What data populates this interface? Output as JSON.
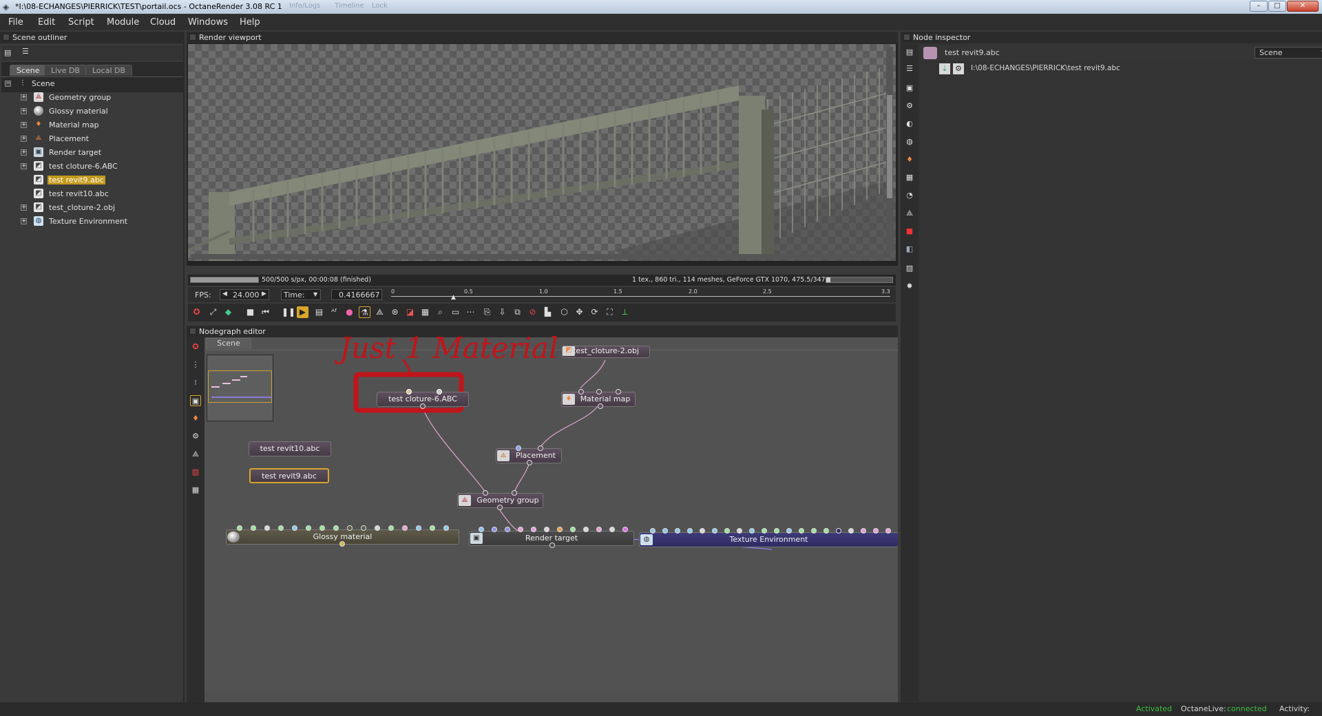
{
  "window": {
    "title": "*I:\\08-ECHANGES\\PIERRICK\\TEST\\portail.ocs - OctaneRender 3.08 RC 1",
    "ghost_tabs": [
      "Info/Logs",
      "Timeline",
      "Lock"
    ],
    "controls": {
      "minimize": "–",
      "maximize": "□",
      "close": "✕"
    }
  },
  "menu": [
    "File",
    "Edit",
    "Script",
    "Module",
    "Cloud",
    "Windows",
    "Help"
  ],
  "outliner": {
    "title": "Scene outliner",
    "tabs": [
      "Scene",
      "Live DB",
      "Local DB"
    ],
    "root": "Scene",
    "items": [
      {
        "label": "Geometry group",
        "icon": "geometry-group-icon",
        "expandable": true,
        "selected": false
      },
      {
        "label": "Glossy material",
        "icon": "glossy-material-icon",
        "expandable": true,
        "selected": false
      },
      {
        "label": "Material map",
        "icon": "material-map-icon",
        "expandable": true,
        "selected": false
      },
      {
        "label": "Placement",
        "icon": "placement-icon",
        "expandable": true,
        "selected": false
      },
      {
        "label": "Render target",
        "icon": "render-target-icon",
        "expandable": true,
        "selected": false
      },
      {
        "label": "test cloture-6.ABC",
        "icon": "mesh-icon",
        "expandable": true,
        "selected": false
      },
      {
        "label": "test revit9.abc",
        "icon": "mesh-icon",
        "expandable": false,
        "selected": true
      },
      {
        "label": "test revit10.abc",
        "icon": "mesh-icon",
        "expandable": false,
        "selected": false
      },
      {
        "label": "test_cloture-2.obj",
        "icon": "mesh-icon",
        "expandable": true,
        "selected": false
      },
      {
        "label": "Texture Environment",
        "icon": "texture-environment-icon",
        "expandable": true,
        "selected": false
      }
    ]
  },
  "viewport": {
    "title": "Render viewport",
    "status_left": "500/500 s/px, 00:00:08 (finished)",
    "status_right": "1 tex., 860 tri., 114 meshes, GeForce GTX 1070, 475.5/3475/8192 MB",
    "fps_label": "FPS:",
    "fps_value": "24.000",
    "time_label": "Time:",
    "time_value": "0.4166667",
    "timeline_ticks": [
      "0",
      "0.5",
      "1.0",
      "1.5",
      "2.0",
      "2.5",
      "3.3"
    ],
    "playhead": 0.4166667,
    "timeline_end": 3.3
  },
  "nodegraph": {
    "title": "Nodegraph editor",
    "tab": "Scene",
    "annotation": "Just 1 Material",
    "nodes": {
      "cloture_top": "test_cloture-2.obj",
      "cloture6": "test cloture-6.ABC",
      "material_map": "Material map",
      "placement": "Placement",
      "revit10": "test revit10.abc",
      "revit9": "test revit9.abc",
      "geometry_group": "Geometry group",
      "glossy": "Glossy material",
      "render_target": "Render target",
      "texture_env": "Texture Environment"
    }
  },
  "inspector": {
    "title": "Node inspector",
    "node_name": "test revit9.abc",
    "dropdown": "Scene",
    "file_path": "I:\\08-ECHANGES\\PIERRICK\\test revit9.abc"
  },
  "statusbar": {
    "activated": "Activated",
    "live_label": "OctaneLive:",
    "live_value": "connected",
    "activity": "Activity:"
  },
  "colors": {
    "selection": "#c39a1e",
    "annotation": "#c0151b",
    "connected": "#3fbf3f",
    "node": "#4f424f",
    "wire": "#d79fc9"
  }
}
